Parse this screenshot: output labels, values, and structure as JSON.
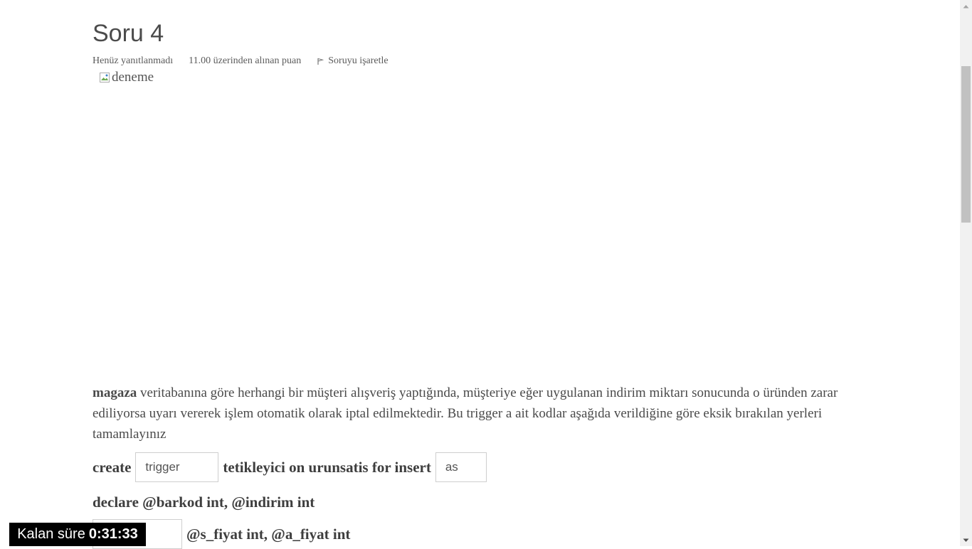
{
  "question": {
    "title": "Soru 4",
    "state": "Henüz yanıtlanmadı",
    "grade": "11.00 üzerinden alınan puan",
    "flag_label": "Soruyu işaretle",
    "image_alt": "deneme",
    "text_bold": "magaza",
    "text_rest": " veritabanına göre herhangi bir müşteri alışveriş yaptığında, müşteriye eğer uygulanan indirim miktarı sonucunda o üründen zarar ediliyorsa uyarı vererek işlem otomatik olarak iptal edilmektedir. Bu trigger a ait kodlar aşağıda verildiğine göre eksik bırakılan yerleri tamamlayınız"
  },
  "code": {
    "line1_a": "create",
    "blank1_value": "trigger",
    "line1_b": "tetikleyici on urunsatis for insert",
    "blank2_value": "as",
    "line2": "declare @barkod int, @indirim int",
    "blank3_value": "",
    "line3": "@s_fiyat int, @a_fiyat int"
  },
  "timer": {
    "label": "Kalan süre",
    "value": "0:31:33"
  }
}
